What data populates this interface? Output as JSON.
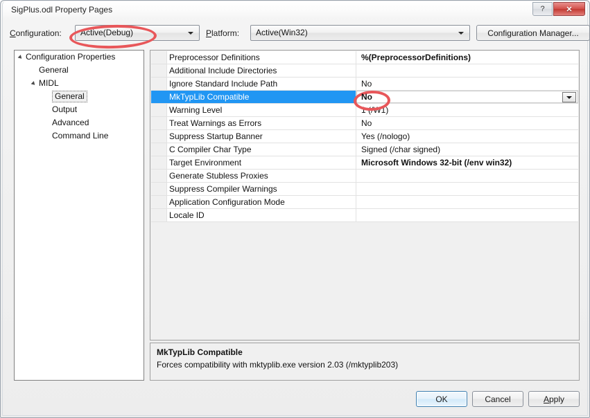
{
  "window": {
    "title": "SigPlus.odl Property Pages",
    "help_button": "?",
    "close_button": "✕"
  },
  "configbar": {
    "configuration_label": "Configuration:",
    "configuration_value": "Active(Debug)",
    "platform_label": "Platform:",
    "platform_value": "Active(Win32)",
    "configuration_manager_button": "Configuration Manager..."
  },
  "tree": {
    "items": [
      {
        "label": "Configuration Properties",
        "indent": 0,
        "expander": true,
        "selected": false
      },
      {
        "label": "General",
        "indent": 1,
        "expander": false,
        "selected": false
      },
      {
        "label": "MIDL",
        "indent": 1,
        "expander": true,
        "selected": false
      },
      {
        "label": "General",
        "indent": 2,
        "expander": false,
        "selected": true
      },
      {
        "label": "Output",
        "indent": 2,
        "expander": false,
        "selected": false
      },
      {
        "label": "Advanced",
        "indent": 2,
        "expander": false,
        "selected": false
      },
      {
        "label": "Command Line",
        "indent": 2,
        "expander": false,
        "selected": false
      }
    ]
  },
  "grid": {
    "rows": [
      {
        "name": "Preprocessor Definitions",
        "value": "%(PreprocessorDefinitions)",
        "bold": true,
        "selected": false,
        "editing": false
      },
      {
        "name": "Additional Include Directories",
        "value": "",
        "bold": false,
        "selected": false,
        "editing": false
      },
      {
        "name": "Ignore Standard Include Path",
        "value": "No",
        "bold": false,
        "selected": false,
        "editing": false
      },
      {
        "name": "MkTypLib Compatible",
        "value": "No",
        "bold": true,
        "selected": true,
        "editing": true
      },
      {
        "name": "Warning Level",
        "value": "1 (/W1)",
        "bold": false,
        "selected": false,
        "editing": false
      },
      {
        "name": "Treat Warnings as Errors",
        "value": "No",
        "bold": false,
        "selected": false,
        "editing": false
      },
      {
        "name": "Suppress Startup Banner",
        "value": "Yes (/nologo)",
        "bold": false,
        "selected": false,
        "editing": false
      },
      {
        "name": "C Compiler Char Type",
        "value": "Signed (/char signed)",
        "bold": false,
        "selected": false,
        "editing": false
      },
      {
        "name": "Target Environment",
        "value": "Microsoft Windows 32-bit (/env win32)",
        "bold": true,
        "selected": false,
        "editing": false
      },
      {
        "name": "Generate Stubless Proxies",
        "value": "",
        "bold": false,
        "selected": false,
        "editing": false
      },
      {
        "name": "Suppress Compiler Warnings",
        "value": "",
        "bold": false,
        "selected": false,
        "editing": false
      },
      {
        "name": "Application Configuration Mode",
        "value": "",
        "bold": false,
        "selected": false,
        "editing": false
      },
      {
        "name": "Locale ID",
        "value": "",
        "bold": false,
        "selected": false,
        "editing": false
      }
    ]
  },
  "description": {
    "title": "MkTypLib Compatible",
    "text": "Forces compatibility with mktyplib.exe version 2.03 (/mktyplib203)"
  },
  "footer": {
    "ok_label": "OK",
    "cancel_label": "Cancel",
    "apply_label": "Apply"
  },
  "annotations": {
    "color": "#e8575a",
    "targets": [
      "configuration-combo",
      "mktyplib-value"
    ]
  }
}
